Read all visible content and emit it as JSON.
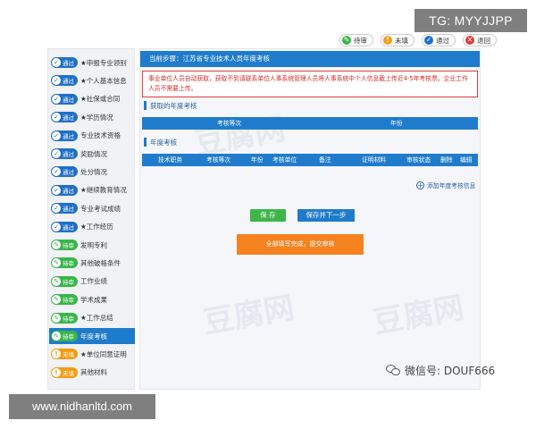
{
  "watermarks": {
    "tg": "TG: MYYJJPP",
    "url": "www.nidhanltd.com",
    "wechat": "微信号: DOUF666"
  },
  "legend": [
    {
      "label": "待审",
      "color": "#39b54a",
      "icon": "pencil-icon",
      "glyph": "✎"
    },
    {
      "label": "未填",
      "color": "#f39c12",
      "icon": "exclamation-icon",
      "glyph": "!"
    },
    {
      "label": "通过",
      "color": "#1f6fc8",
      "icon": "check-icon",
      "glyph": "✓"
    },
    {
      "label": "退回",
      "color": "#e03b3b",
      "icon": "x-icon",
      "glyph": "✕"
    }
  ],
  "sidebar": {
    "items": [
      {
        "status": "pass",
        "status_label": "通过",
        "glyph": "✓",
        "required": "★",
        "label": "申报专业领别"
      },
      {
        "status": "pass",
        "status_label": "通过",
        "glyph": "✓",
        "required": "★",
        "label": "个人基本信息"
      },
      {
        "status": "pass",
        "status_label": "通过",
        "glyph": "✓",
        "required": "★",
        "label": "社保或合同"
      },
      {
        "status": "pass",
        "status_label": "通过",
        "glyph": "✓",
        "required": "★",
        "label": "学历情况"
      },
      {
        "status": "pass",
        "status_label": "通过",
        "glyph": "✓",
        "required": "",
        "label": "专业技术资格"
      },
      {
        "status": "pass",
        "status_label": "通过",
        "glyph": "✓",
        "required": "",
        "label": "奖励情况"
      },
      {
        "status": "pass",
        "status_label": "通过",
        "glyph": "✓",
        "required": "",
        "label": "处分情况"
      },
      {
        "status": "pass",
        "status_label": "通过",
        "glyph": "✓",
        "required": "★",
        "label": "继续教育情况"
      },
      {
        "status": "pass",
        "status_label": "通过",
        "glyph": "✓",
        "required": "",
        "label": "专业考试成绩"
      },
      {
        "status": "pass",
        "status_label": "通过",
        "glyph": "✓",
        "required": "★",
        "label": "工作经历"
      },
      {
        "status": "wait",
        "status_label": "待审",
        "glyph": "✎",
        "required": "",
        "label": "发明专利"
      },
      {
        "status": "wait",
        "status_label": "待审",
        "glyph": "✎",
        "required": "",
        "label": "其他破格条件"
      },
      {
        "status": "wait",
        "status_label": "待审",
        "glyph": "✎",
        "required": "",
        "label": "工作业绩"
      },
      {
        "status": "wait",
        "status_label": "待审",
        "glyph": "✎",
        "required": "",
        "label": "学术成果"
      },
      {
        "status": "wait",
        "status_label": "待审",
        "glyph": "✎",
        "required": "★",
        "label": "工作总结"
      },
      {
        "status": "wait",
        "status_label": "待审",
        "glyph": "✎",
        "required": "",
        "label": "年度考核",
        "active": true
      },
      {
        "status": "miss",
        "status_label": "未填",
        "glyph": "!",
        "required": "★",
        "label": "单位同意证明"
      },
      {
        "status": "miss",
        "status_label": "未填",
        "glyph": "!",
        "required": "",
        "label": "其他材料"
      }
    ]
  },
  "main": {
    "step": "当前步骤：江苏省专业技术人员年度考核",
    "notice": "事业单位人员自动获取，获取不到请联系单位人事系统管理人员将人事系统中个人信息截上传近4-5年考核票。企业工作人员不需要上传。",
    "section1": {
      "title": "获取的年度考核",
      "columns": [
        "考核等次",
        "年份"
      ]
    },
    "section2": {
      "title": "年度考核",
      "columns": [
        "技术职务",
        "考核等次",
        "年份",
        "考核单位",
        "备注",
        "证明材料",
        "审核状态",
        "删除",
        "编辑"
      ]
    },
    "add_link": "添加年度考核信息",
    "buttons": {
      "save": "保 存",
      "save_next": "保存并下一步",
      "submit": "全部填写完成，提交审核"
    }
  }
}
